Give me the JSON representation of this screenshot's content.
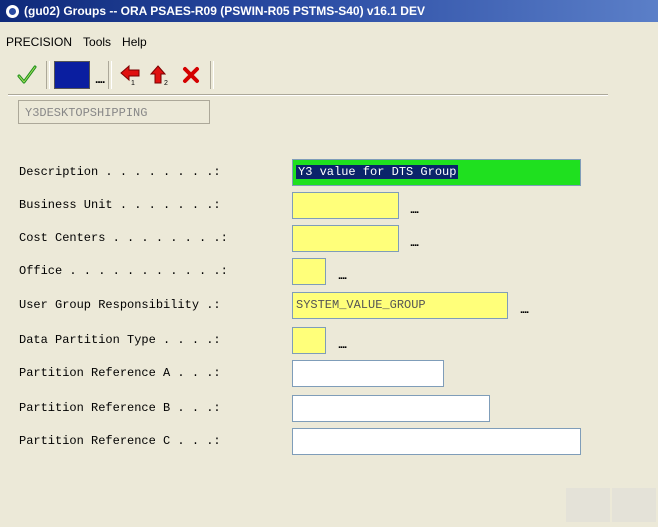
{
  "window": {
    "title": "(gu02) Groups -- ORA PSAES-R09 (PSWIN-R05 PSTMS-S40) v16.1 DEV"
  },
  "menu": [
    "PRECISION",
    "Tools",
    "Help"
  ],
  "toolbar": {
    "ok_icon": "checkmark-icon",
    "browse_label": "...."
  },
  "key_field": {
    "value": "Y3DESKTOPSHIPPING"
  },
  "form": {
    "rows": [
      {
        "label": "Description . . . . . . . .:",
        "value": "Y3 value for DTS Group",
        "ellipsis": ""
      },
      {
        "label": "Business Unit . . . . . . .:",
        "value": "",
        "ellipsis": "...."
      },
      {
        "label": "Cost Centers . . . . . . . .:",
        "value": "",
        "ellipsis": "...."
      },
      {
        "label": "Office . . . . . . . . . . .:",
        "value": "",
        "ellipsis": "...."
      },
      {
        "label": "User Group Responsibility .:",
        "value": "SYSTEM_VALUE_GROUP",
        "ellipsis": "...."
      },
      {
        "label": "Data Partition Type . . . .:",
        "value": "",
        "ellipsis": "...."
      },
      {
        "label": "Partition Reference A . . .:",
        "value": "",
        "ellipsis": ""
      },
      {
        "label": "Partition Reference B . . .:",
        "value": "",
        "ellipsis": ""
      },
      {
        "label": "Partition Reference C . . .:",
        "value": "",
        "ellipsis": ""
      }
    ]
  },
  "colors": {
    "required_field": "#ffff7a",
    "active_field": "#1fe01f",
    "title_bar": "#1f3a8f",
    "bluebox": "#0a1ea0"
  }
}
